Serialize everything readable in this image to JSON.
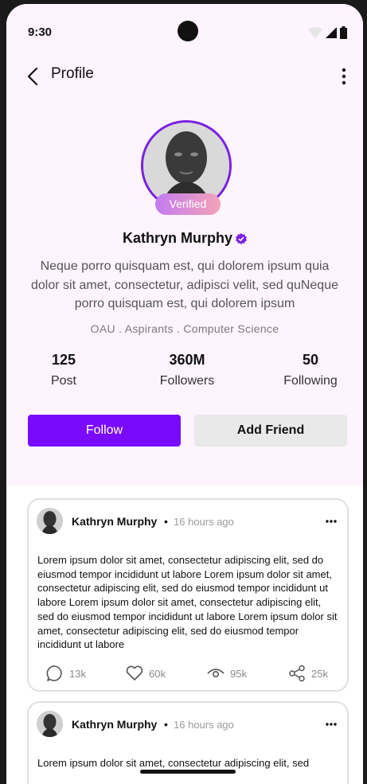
{
  "status_bar": {
    "time": "9:30",
    "icons": [
      "wifi-icon",
      "signal-icon",
      "battery-icon"
    ]
  },
  "app_bar": {
    "title": "Profile",
    "icons": [
      "back-arrow-icon",
      "more-vertical-icon"
    ]
  },
  "profile": {
    "verified_label": "Verified",
    "name": "Kathryn Murphy",
    "bio": "Neque porro quisquam est, qui dolorem ipsum quia dolor sit amet, consectetur, adipisci velit, sed quNeque porro quisquam est, qui dolorem ipsum",
    "meta": "OAU . Aspirants . Computer Science",
    "stats": [
      {
        "value": "125",
        "label": "Post"
      },
      {
        "value": "360M",
        "label": "Followers"
      },
      {
        "value": "50",
        "label": "Following"
      }
    ],
    "follow_label": "Follow",
    "add_friend_label": "Add Friend"
  },
  "posts": [
    {
      "author": "Kathryn Murphy",
      "separator": "•",
      "time_ago": "16 hours ago",
      "text": "Lorem ipsum dolor sit amet, consectetur adipiscing elit, sed do eiusmod tempor incididunt ut labore Lorem ipsum dolor sit amet, consectetur adipiscing elit, sed do eiusmod tempor incididunt ut labore Lorem ipsum dolor sit amet, consectetur adipiscing elit, sed do eiusmod tempor incididunt ut labore Lorem ipsum dolor sit amet, consectetur adipiscing elit, sed do eiusmod tempor incididunt ut labore",
      "comments": "13k",
      "likes": "60k",
      "views": "95k",
      "shares": "25k"
    },
    {
      "author": "Kathryn Murphy",
      "separator": "•",
      "time_ago": "16 hours ago",
      "text": "Lorem ipsum dolor sit amet, consectetur adipiscing elit, sed"
    }
  ],
  "colors": {
    "accent": "#7a0afe",
    "ring": "#7a1fe0",
    "verified_start": "#c27cf0",
    "verified_end": "#f4a2b7",
    "header_bg": "#fdf4fd"
  }
}
